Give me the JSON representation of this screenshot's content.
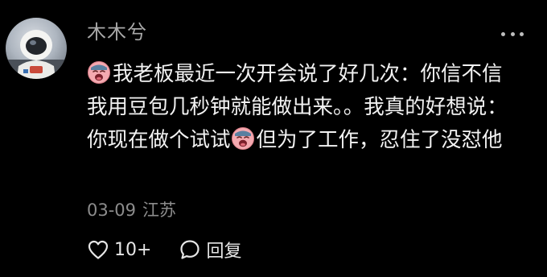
{
  "comment": {
    "username": "木木兮",
    "text_line_parts": {
      "part1": "我老板最近一次开会说了好几次：你信不信 我用豆包几秒钟就能做出来。。我真的好想说：你现在做个试试",
      "part2": "但为了工作，忍住了没怼他"
    },
    "date": "03-09",
    "location": "江苏",
    "like_count": "10+",
    "reply_label": "回复"
  },
  "icons": {
    "avatar": "astronaut-avatar",
    "more": "more-dots-icon",
    "emoji": "crying-emoji-icon",
    "like": "heart-outline-icon",
    "reply": "speech-bubble-icon"
  },
  "colors": {
    "background": "#000000",
    "username": "#a8a8a8",
    "text": "#f2f2f2",
    "meta": "#8c8c8c",
    "emoji_face": "#f2a0a8"
  }
}
